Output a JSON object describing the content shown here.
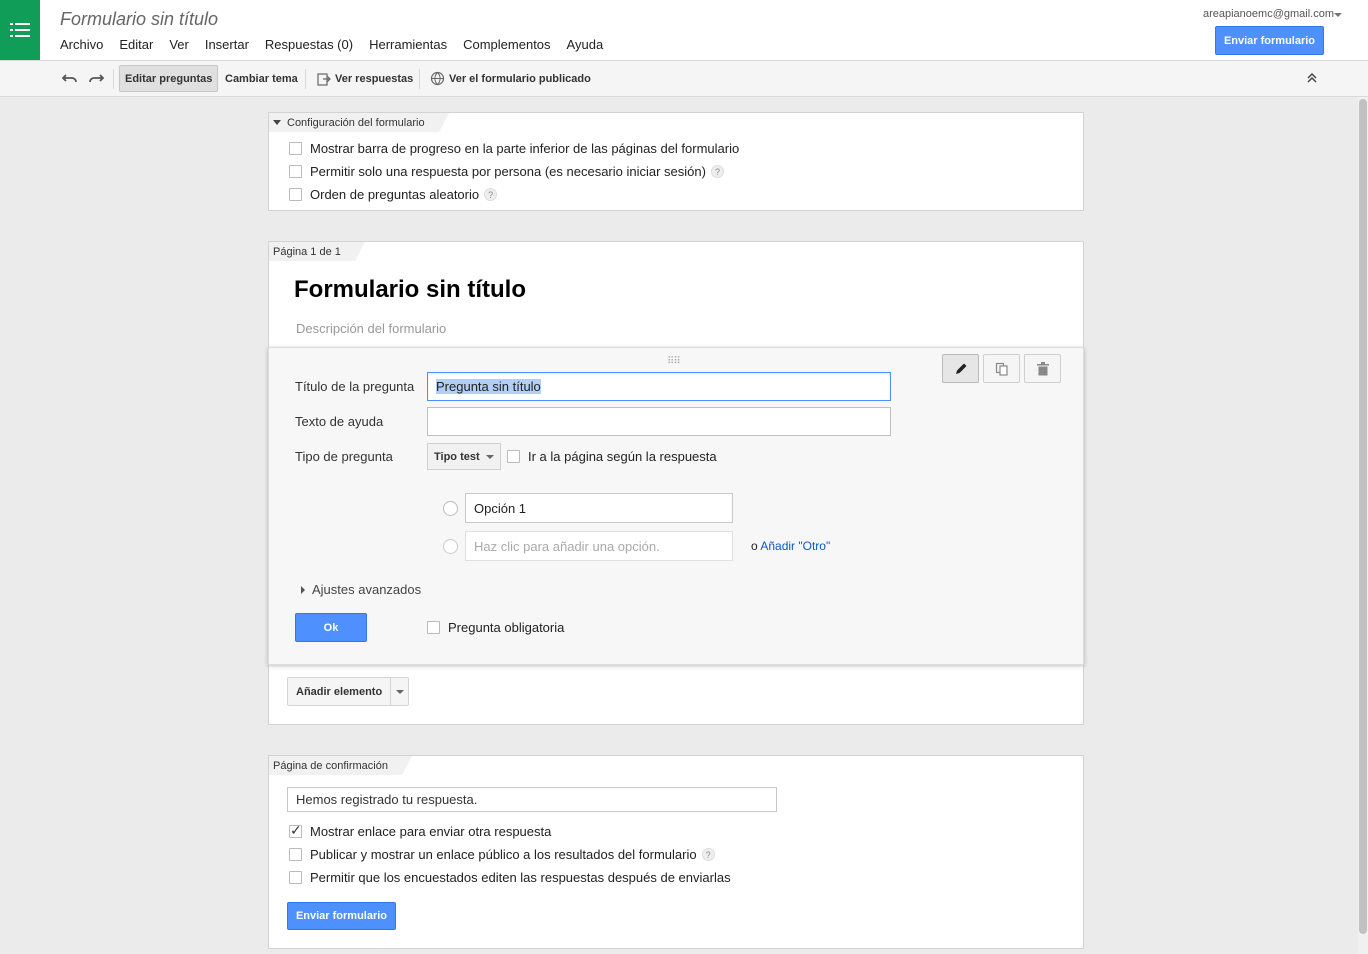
{
  "app": {
    "doc_title": "Formulario sin título",
    "account": "areapianoemc@gmail.com",
    "send_button": "Enviar formulario"
  },
  "menu": [
    "Archivo",
    "Editar",
    "Ver",
    "Insertar",
    "Respuestas (0)",
    "Herramientas",
    "Complementos",
    "Ayuda"
  ],
  "toolbar": {
    "edit_questions": "Editar preguntas",
    "change_theme": "Cambiar tema",
    "view_responses": "Ver respuestas",
    "view_published": "Ver el formulario publicado"
  },
  "settings": {
    "tab": "Configuración del formulario",
    "options": [
      {
        "label": "Mostrar barra de progreso en la parte inferior de las páginas del formulario",
        "checked": false,
        "help": false
      },
      {
        "label": "Permitir solo una respuesta por persona (es necesario iniciar sesión)",
        "checked": false,
        "help": true
      },
      {
        "label": "Orden de preguntas aleatorio",
        "checked": false,
        "help": true
      }
    ]
  },
  "page": {
    "tab": "Página 1 de 1",
    "title": "Formulario sin título",
    "description_placeholder": "Descripción del formulario"
  },
  "question": {
    "title_label": "Título de la pregunta",
    "title_value": "Pregunta sin título",
    "help_label": "Texto de ayuda",
    "help_value": "",
    "type_label": "Tipo de pregunta",
    "type_value": "Tipo test",
    "goto_page_label": "Ir a la página según la respuesta",
    "option_1": "Opción 1",
    "add_option_placeholder": "Haz clic para añadir una opción.",
    "or_text": "o",
    "add_other": "Añadir \"Otro\"",
    "advanced": "Ajustes avanzados",
    "ok": "Ok",
    "required_label": "Pregunta obligatoria"
  },
  "add_item": "Añadir elemento",
  "confirmation": {
    "tab": "Página de confirmación",
    "message": "Hemos registrado tu respuesta.",
    "options": [
      {
        "label": "Mostrar enlace para enviar otra respuesta",
        "checked": true,
        "help": false
      },
      {
        "label": "Publicar y mostrar un enlace público a los resultados del formulario",
        "checked": false,
        "help": true
      },
      {
        "label": "Permitir que los encuestados editen las respuestas después de enviarlas",
        "checked": false,
        "help": false
      }
    ],
    "send_button": "Enviar formulario"
  },
  "help_glyph": "?"
}
